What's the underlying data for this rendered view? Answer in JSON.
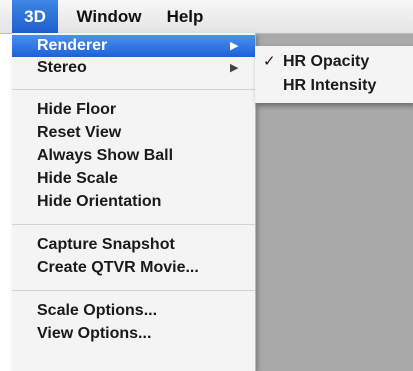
{
  "menubar": {
    "items": [
      {
        "label": "3D"
      },
      {
        "label": "Window"
      },
      {
        "label": "Help"
      }
    ]
  },
  "menu": {
    "items": [
      {
        "label": "Renderer",
        "submenu": true
      },
      {
        "label": "Stereo",
        "submenu": true
      },
      {
        "label": "Hide Floor"
      },
      {
        "label": "Reset View"
      },
      {
        "label": "Always Show Ball"
      },
      {
        "label": "Hide Scale"
      },
      {
        "label": "Hide Orientation"
      },
      {
        "label": "Capture Snapshot"
      },
      {
        "label": "Create QTVR Movie..."
      },
      {
        "label": "Scale Options..."
      },
      {
        "label": "View Options..."
      }
    ],
    "arrow_glyph": "▶"
  },
  "submenu": {
    "items": [
      {
        "label": "HR Opacity",
        "checked": true,
        "check_glyph": "✓"
      },
      {
        "label": "HR Intensity",
        "checked": false
      }
    ]
  },
  "colors": {
    "highlight": "#1d62d6",
    "desktop": "#a9a9a9",
    "menu_bg": "#f4f4f4"
  }
}
